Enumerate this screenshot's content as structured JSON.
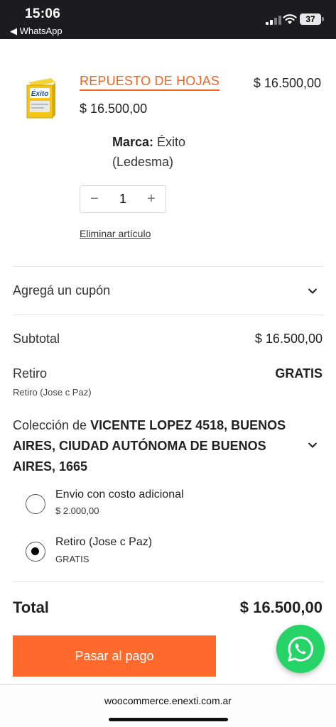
{
  "status_bar": {
    "time": "15:06",
    "back_app": "◀ WhatsApp",
    "battery": "37"
  },
  "product": {
    "name": "REPUESTO DE HOJAS",
    "line_price": "$ 16.500,00",
    "unit_price": "$ 16.500,00",
    "meta_key": "Marca:",
    "meta_value": "Éxito (Ledesma)",
    "quantity": "1",
    "remove_label": "Eliminar artículo",
    "image_text": "Éxito"
  },
  "coupon": {
    "label": "Agregá un cupón"
  },
  "summary": {
    "subtotal_label": "Subtotal",
    "subtotal_value": "$ 16.500,00",
    "shipping_label": "Retiro",
    "shipping_value": "GRATIS",
    "shipping_sub": "Retiro (Jose c Paz)"
  },
  "collection": {
    "prefix": "Colección de",
    "address": "VICENTE LOPEZ 4518, BUENOS AIRES, CIUDAD AUTÓNOMA DE BUENOS AIRES, 1665"
  },
  "shipping_options": [
    {
      "title": "Envio con costo adicional",
      "price": "$ 2.000,00",
      "selected": false
    },
    {
      "title": "Retiro (Jose c Paz)",
      "price": "GRATIS",
      "selected": true
    }
  ],
  "total": {
    "label": "Total",
    "value": "$ 16.500,00"
  },
  "checkout": {
    "label": "Pasar al pago"
  },
  "browser": {
    "domain": "woocommerce.enexti.com.ar"
  },
  "colors": {
    "accent": "#ff6a2c",
    "link": "#f26522",
    "whatsapp": "#25d366"
  },
  "icons": {
    "coupon_toggle": "chevron-down-icon",
    "collection_toggle": "chevron-down-icon",
    "floating_button": "whatsapp-icon"
  }
}
